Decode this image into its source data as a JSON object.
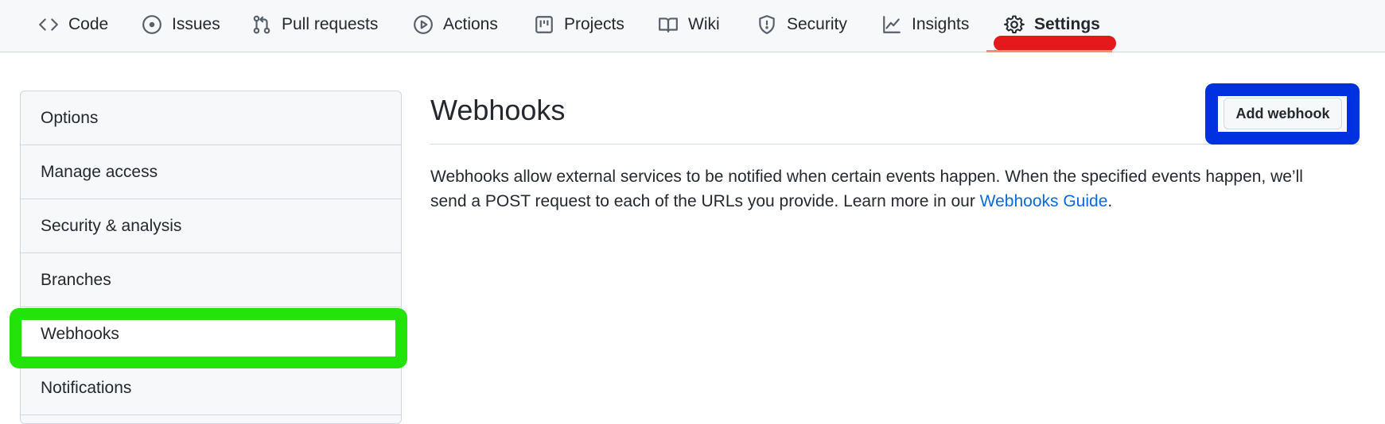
{
  "tabs": [
    {
      "label": "Code",
      "icon": "code-icon"
    },
    {
      "label": "Issues",
      "icon": "issue-icon"
    },
    {
      "label": "Pull requests",
      "icon": "pull-request-icon"
    },
    {
      "label": "Actions",
      "icon": "play-icon"
    },
    {
      "label": "Projects",
      "icon": "project-icon"
    },
    {
      "label": "Wiki",
      "icon": "book-icon"
    },
    {
      "label": "Security",
      "icon": "shield-icon"
    },
    {
      "label": "Insights",
      "icon": "graph-icon"
    },
    {
      "label": "Settings",
      "icon": "gear-icon",
      "selected": true
    }
  ],
  "sidebar": {
    "items": [
      {
        "label": "Options"
      },
      {
        "label": "Manage access"
      },
      {
        "label": "Security & analysis"
      },
      {
        "label": "Branches"
      },
      {
        "label": "Webhooks",
        "active": true
      },
      {
        "label": "Notifications"
      }
    ]
  },
  "main": {
    "title": "Webhooks",
    "add_button": "Add webhook",
    "description_before": "Webhooks allow external services to be notified when certain events happen. When the specified events happen, we’ll send a POST request to each of the URLs you provide. Learn more in our ",
    "description_link": "Webhooks Guide",
    "description_after": "."
  },
  "colors": {
    "link": "#0969da",
    "selected_tab_underline": "#fd8c73",
    "annotation_red": "#e3191b",
    "annotation_green": "#24e30a",
    "annotation_blue": "#0031e0"
  }
}
